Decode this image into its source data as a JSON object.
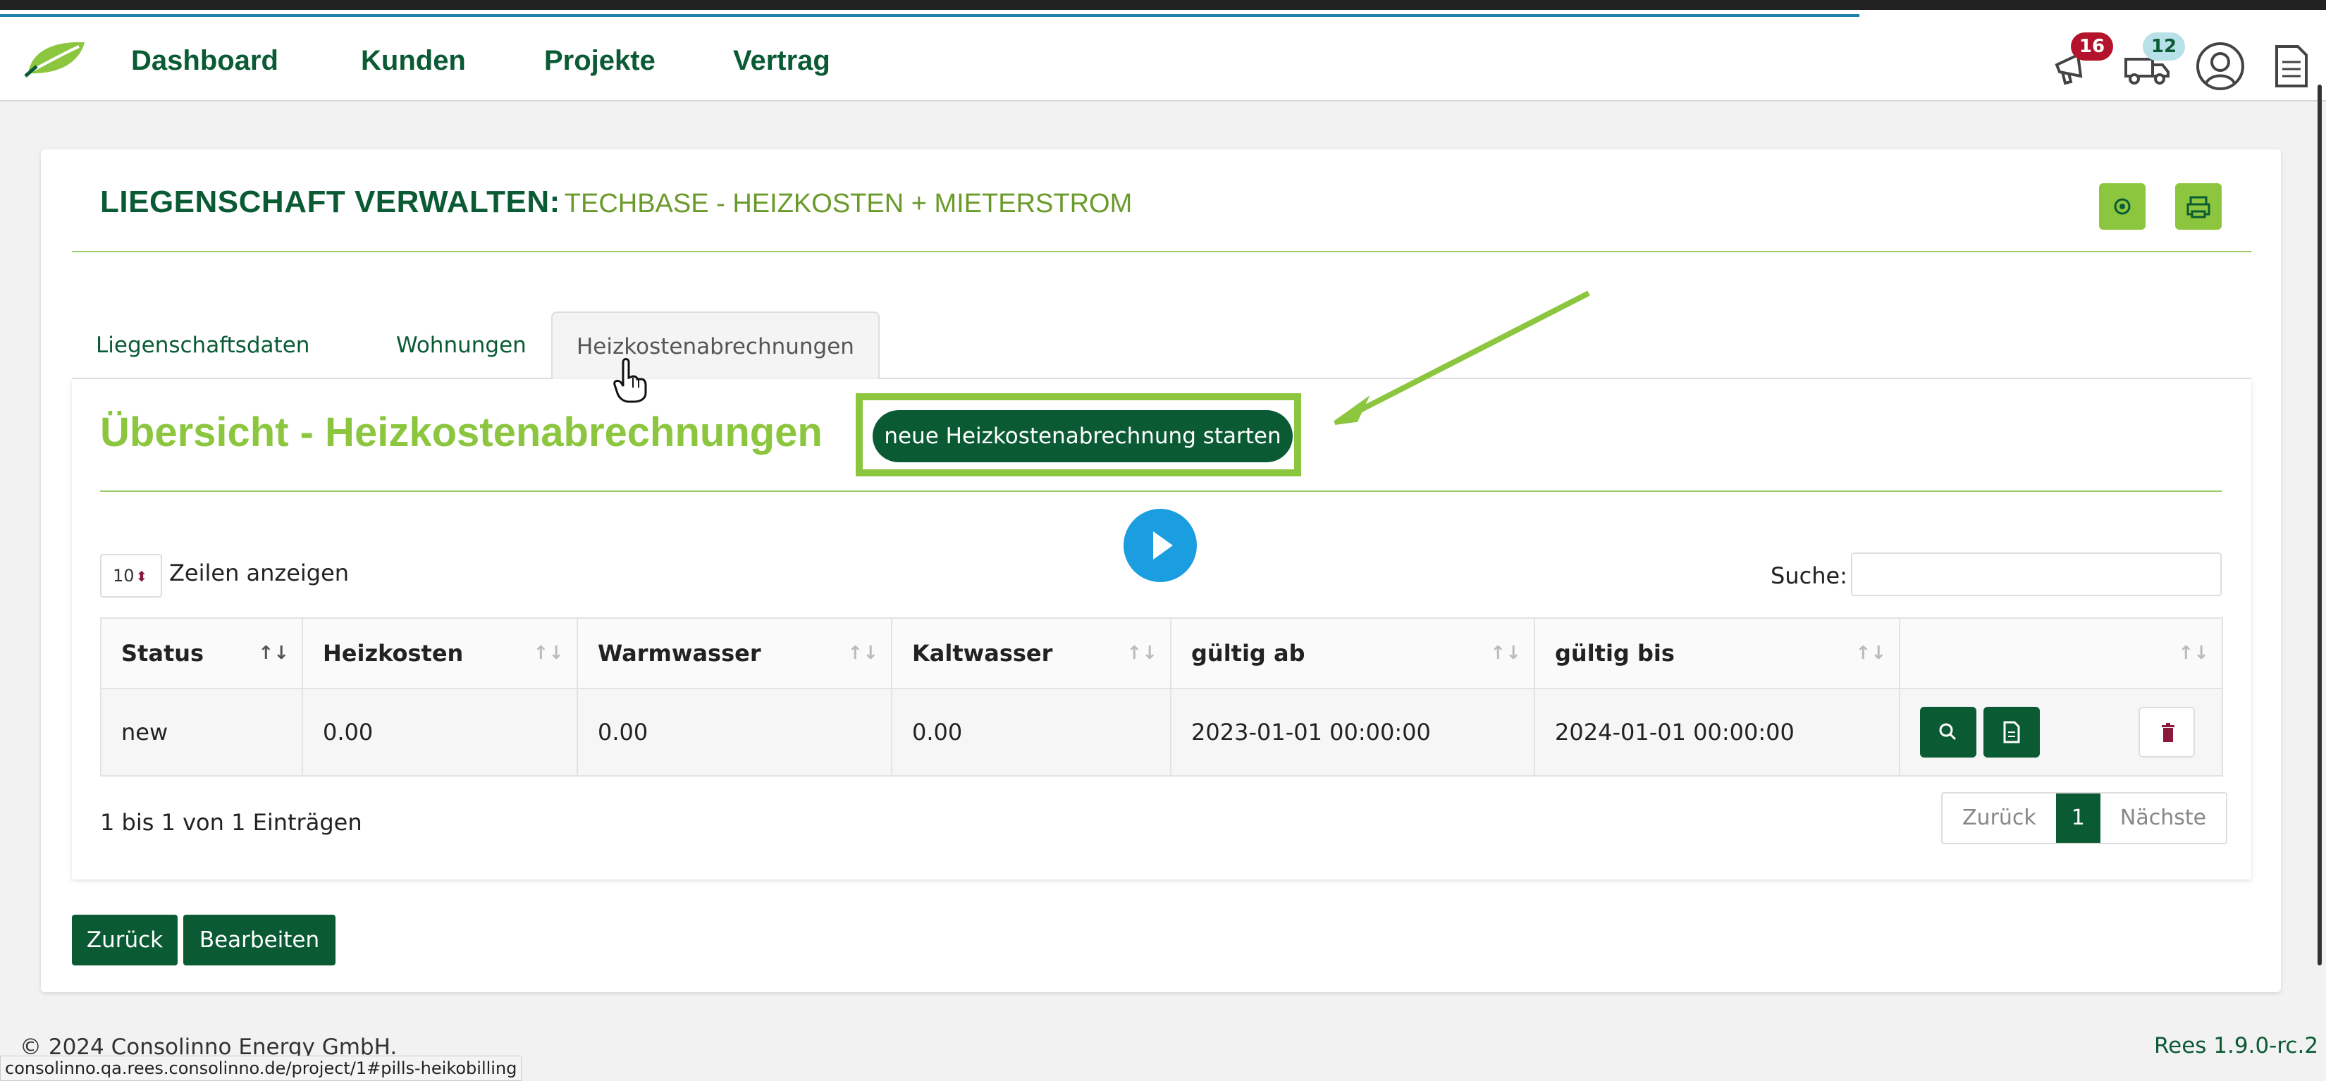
{
  "nav": {
    "items": [
      "Dashboard",
      "Kunden",
      "Projekte",
      "Vertrag"
    ],
    "notifications_count": "16",
    "truck_count": "12"
  },
  "header": {
    "title_strong": "LIEGENSCHAFT VERWALTEN:",
    "title_sub": "TECHBASE - HEIZKOSTEN + MIETERSTROM"
  },
  "tabs": [
    "Liegenschaftsdaten",
    "Wohnungen",
    "Heizkostenabrechnungen"
  ],
  "section": {
    "title": "Übersicht - Heizkostenabrechnungen",
    "new_button": "neue Heizkostenabrechnung starten"
  },
  "table_controls": {
    "length_value": "10",
    "length_label": "Zeilen anzeigen",
    "search_label": "Suche:"
  },
  "table": {
    "headers": [
      "Status",
      "Heizkosten",
      "Warmwasser",
      "Kaltwasser",
      "gültig ab",
      "gültig bis",
      ""
    ],
    "rows": [
      [
        "new",
        "0.00",
        "0.00",
        "0.00",
        "2023-01-01 00:00:00",
        "2024-01-01 00:00:00"
      ]
    ]
  },
  "pagination": {
    "info": "1 bis 1 von 1 Einträgen",
    "prev": "Zurück",
    "current": "1",
    "next": "Nächste"
  },
  "buttons": {
    "back": "Zurück",
    "edit": "Bearbeiten"
  },
  "footer": {
    "copyright": "© 2024 Consolinno Energy GmbH.",
    "version": "Rees 1.9.0-rc.2"
  },
  "status_url": "consolinno.qa.rees.consolinno.de/project/1#pills-heikobilling",
  "colors": {
    "primary": "#0a5b34",
    "accent": "#8cc63f",
    "play": "#1b9ee0",
    "badge_red": "#b3132b"
  },
  "icons": [
    "leaf-logo-icon",
    "megaphone-icon",
    "truck-icon",
    "user-circle-icon",
    "document-icon",
    "gear-icon",
    "print-icon",
    "play-icon",
    "search-icon",
    "file-icon",
    "trash-icon",
    "hand-cursor-icon"
  ]
}
